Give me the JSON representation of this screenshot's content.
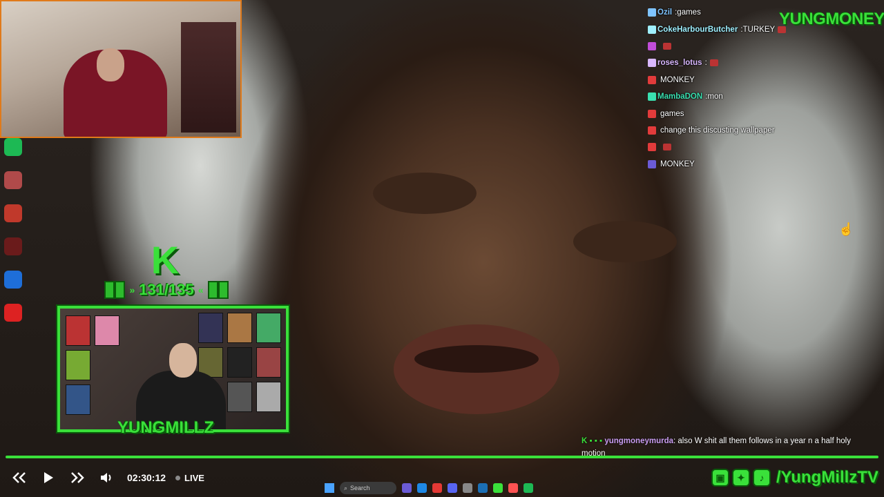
{
  "chat": [
    {
      "user": "Ozil",
      "user_color": "#7fc4ff",
      "message": "games",
      "emote": false
    },
    {
      "user": "CokeHarbourButcher",
      "user_color": "#9ff0ff",
      "message": "TURKEY",
      "emote": true
    },
    {
      "user": "",
      "user_color": "#c14dd9",
      "message": "",
      "emote": true
    },
    {
      "user": "roses_lotus",
      "user_color": "#d9b8ff",
      "message": "",
      "emote": true
    },
    {
      "user": "",
      "user_color": "#e23b3b",
      "message": "MONKEY",
      "emote": false
    },
    {
      "user": "MambaDON",
      "user_color": "#3ae0b0",
      "message": "mon",
      "emote": false
    },
    {
      "user": "",
      "user_color": "#e23b3b",
      "message": "games",
      "emote": false
    },
    {
      "user": "",
      "user_color": "#e23b3b",
      "message": "change this discusting wallpaper",
      "emote": false
    },
    {
      "user": "",
      "user_color": "#e23b3b",
      "message": "",
      "emote": true
    },
    {
      "user": "",
      "user_color": "#6b5bd6",
      "message": "MONKEY",
      "emote": false
    }
  ],
  "brand_top": "YUNGMONEY",
  "goal": {
    "count": "131/135",
    "left_arrow": "»",
    "right_arrow": "«",
    "logo": "K"
  },
  "cam_name": "YUNGMILLZ",
  "notice": {
    "user": "yungmoneymurda",
    "message": "also W shit all them follows in a year n a half holy motion"
  },
  "player": {
    "time": "02:30:12",
    "live_label": "LIVE",
    "progress": 1.0
  },
  "taskbar": {
    "search_placeholder": "Search"
  },
  "social": {
    "handle": "/YungMillzTV"
  },
  "colors": {
    "accent": "#3ae03a",
    "accent_dark": "#0a5a0a",
    "cam_border_top": "#e07a1a"
  },
  "icons": {
    "rewind": "rewind-icon",
    "play": "play-icon",
    "forward": "forward-icon",
    "volume": "volume-icon",
    "windows": "windows-start-icon"
  }
}
